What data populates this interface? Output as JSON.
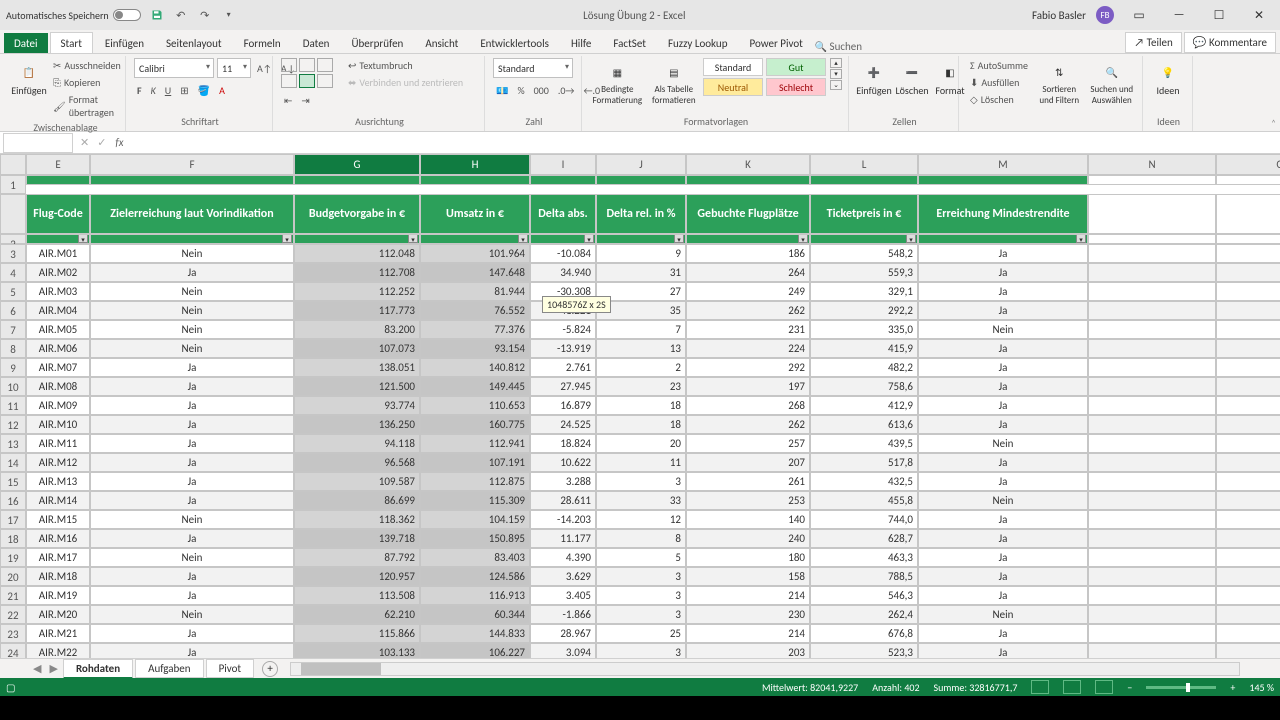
{
  "title": "Lösung Übung 2 - Excel",
  "autosave_label": "Automatisches Speichern",
  "user": {
    "name": "Fabio Basler",
    "initials": "FB"
  },
  "file_tab": "Datei",
  "tabs": [
    "Start",
    "Einfügen",
    "Seitenlayout",
    "Formeln",
    "Daten",
    "Überprüfen",
    "Ansicht",
    "Entwicklertools",
    "Hilfe",
    "FactSet",
    "Fuzzy Lookup",
    "Power Pivot"
  ],
  "active_tab": "Start",
  "tell_me": "Suchen",
  "share": "Teilen",
  "comments": "Kommentare",
  "ribbon": {
    "clipboard": {
      "paste": "Einfügen",
      "cut": "Ausschneiden",
      "copy": "Kopieren",
      "format_painter": "Format übertragen",
      "label": "Zwischenablage"
    },
    "font": {
      "name": "Calibri",
      "size": "11",
      "label": "Schriftart"
    },
    "alignment": {
      "wrap": "Textumbruch",
      "merge": "Verbinden und zentrieren",
      "label": "Ausrichtung"
    },
    "number": {
      "format": "Standard",
      "label": "Zahl"
    },
    "styles": {
      "cond": "Bedingte Formatierung",
      "table": "Als Tabelle formatieren",
      "normal": "Standard",
      "gut": "Gut",
      "neutral": "Neutral",
      "schlecht": "Schlecht",
      "label": "Formatvorlagen"
    },
    "cells": {
      "insert": "Einfügen",
      "delete": "Löschen",
      "format": "Format",
      "label": "Zellen"
    },
    "editing": {
      "autosum": "AutoSumme",
      "fill": "Ausfüllen",
      "clear": "Löschen",
      "sort": "Sortieren und Filtern",
      "find": "Suchen und Auswählen",
      "label": ""
    },
    "ideas": {
      "btn": "Ideen",
      "label": "Ideen"
    }
  },
  "tooltip": "1048576Z x 2S",
  "columns": [
    "E",
    "F",
    "G",
    "H",
    "I",
    "J",
    "K",
    "L",
    "M",
    "N",
    "O"
  ],
  "selected_cols": [
    "G",
    "H"
  ],
  "headers": [
    "Flug-Code",
    "Zielerreichung laut Vorindikation",
    "Budgetvorgabe in €",
    "Umsatz in €",
    "Delta abs.",
    "Delta rel. in %",
    "Gebuchte Flugplätze",
    "Ticketpreis in €",
    "Erreichung Mindestrendite"
  ],
  "rows": [
    {
      "n": 3,
      "d": [
        "AIR.M01",
        "Nein",
        "112.048",
        "101.964",
        "-10.084",
        "9",
        "186",
        "548,2",
        "Ja"
      ]
    },
    {
      "n": 4,
      "d": [
        "AIR.M02",
        "Ja",
        "112.708",
        "147.648",
        "34.940",
        "31",
        "264",
        "559,3",
        "Ja"
      ]
    },
    {
      "n": 5,
      "d": [
        "AIR.M03",
        "Nein",
        "112.252",
        "81.944",
        "-30.308",
        "27",
        "249",
        "329,1",
        "Ja"
      ]
    },
    {
      "n": 6,
      "d": [
        "AIR.M04",
        "Nein",
        "117.773",
        "76.552",
        "-41.221",
        "35",
        "262",
        "292,2",
        "Ja"
      ]
    },
    {
      "n": 7,
      "d": [
        "AIR.M05",
        "Nein",
        "83.200",
        "77.376",
        "-5.824",
        "7",
        "231",
        "335,0",
        "Nein"
      ]
    },
    {
      "n": 8,
      "d": [
        "AIR.M06",
        "Nein",
        "107.073",
        "93.154",
        "-13.919",
        "13",
        "224",
        "415,9",
        "Ja"
      ]
    },
    {
      "n": 9,
      "d": [
        "AIR.M07",
        "Ja",
        "138.051",
        "140.812",
        "2.761",
        "2",
        "292",
        "482,2",
        "Ja"
      ]
    },
    {
      "n": 10,
      "d": [
        "AIR.M08",
        "Ja",
        "121.500",
        "149.445",
        "27.945",
        "23",
        "197",
        "758,6",
        "Ja"
      ]
    },
    {
      "n": 11,
      "d": [
        "AIR.M09",
        "Ja",
        "93.774",
        "110.653",
        "16.879",
        "18",
        "268",
        "412,9",
        "Ja"
      ]
    },
    {
      "n": 12,
      "d": [
        "AIR.M10",
        "Ja",
        "136.250",
        "160.775",
        "24.525",
        "18",
        "262",
        "613,6",
        "Ja"
      ]
    },
    {
      "n": 13,
      "d": [
        "AIR.M11",
        "Ja",
        "94.118",
        "112.941",
        "18.824",
        "20",
        "257",
        "439,5",
        "Nein"
      ]
    },
    {
      "n": 14,
      "d": [
        "AIR.M12",
        "Ja",
        "96.568",
        "107.191",
        "10.622",
        "11",
        "207",
        "517,8",
        "Ja"
      ]
    },
    {
      "n": 15,
      "d": [
        "AIR.M13",
        "Ja",
        "109.587",
        "112.875",
        "3.288",
        "3",
        "261",
        "432,5",
        "Ja"
      ]
    },
    {
      "n": 16,
      "d": [
        "AIR.M14",
        "Ja",
        "86.699",
        "115.309",
        "28.611",
        "33",
        "253",
        "455,8",
        "Nein"
      ]
    },
    {
      "n": 17,
      "d": [
        "AIR.M15",
        "Nein",
        "118.362",
        "104.159",
        "-14.203",
        "12",
        "140",
        "744,0",
        "Ja"
      ]
    },
    {
      "n": 18,
      "d": [
        "AIR.M16",
        "Ja",
        "139.718",
        "150.895",
        "11.177",
        "8",
        "240",
        "628,7",
        "Ja"
      ]
    },
    {
      "n": 19,
      "d": [
        "AIR.M17",
        "Nein",
        "87.792",
        "83.403",
        "4.390",
        "5",
        "180",
        "463,3",
        "Ja"
      ]
    },
    {
      "n": 20,
      "d": [
        "AIR.M18",
        "Ja",
        "120.957",
        "124.586",
        "3.629",
        "3",
        "158",
        "788,5",
        "Ja"
      ]
    },
    {
      "n": 21,
      "d": [
        "AIR.M19",
        "Ja",
        "113.508",
        "116.913",
        "3.405",
        "3",
        "214",
        "546,3",
        "Ja"
      ]
    },
    {
      "n": 22,
      "d": [
        "AIR.M20",
        "Nein",
        "62.210",
        "60.344",
        "-1.866",
        "3",
        "230",
        "262,4",
        "Nein"
      ]
    },
    {
      "n": 23,
      "d": [
        "AIR.M21",
        "Ja",
        "115.866",
        "144.833",
        "28.967",
        "25",
        "214",
        "676,8",
        "Ja"
      ]
    },
    {
      "n": 24,
      "d": [
        "AIR.M22",
        "Ja",
        "103.133",
        "106.227",
        "3.094",
        "3",
        "203",
        "523,3",
        "Ja"
      ]
    }
  ],
  "sheet_tabs": [
    "Rohdaten",
    "Aufgaben",
    "Pivot"
  ],
  "active_sheet": "Rohdaten",
  "status": {
    "mean": "Mittelwert: 82041,9227",
    "count": "Anzahl: 402",
    "sum": "Summe: 32816771,7",
    "zoom": "145 %"
  }
}
